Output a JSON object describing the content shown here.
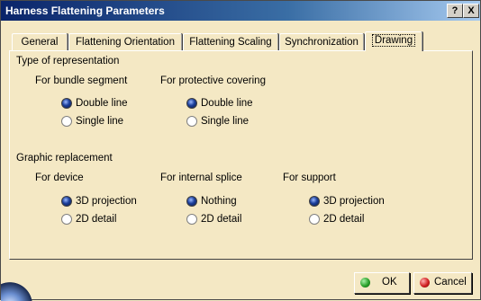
{
  "window": {
    "title": "Harness Flattening Parameters",
    "help_label": "?",
    "close_label": "X"
  },
  "tabs": [
    {
      "label": "General"
    },
    {
      "label": "Flattening Orientation"
    },
    {
      "label": "Flattening Scaling"
    },
    {
      "label": "Synchronization"
    },
    {
      "label": "Drawing"
    }
  ],
  "active_tab": "Drawing",
  "representation": {
    "heading": "Type of representation",
    "bundle": {
      "label": "For bundle segment",
      "options": [
        "Double line",
        "Single line"
      ],
      "selected": "Double line"
    },
    "covering": {
      "label": "For protective covering",
      "options": [
        "Double line",
        "Single line"
      ],
      "selected": "Double line"
    }
  },
  "replacement": {
    "heading": "Graphic replacement",
    "device": {
      "label": "For device",
      "options": [
        "3D projection",
        "2D detail"
      ],
      "selected": "3D projection"
    },
    "splice": {
      "label": "For internal splice",
      "options": [
        "Nothing",
        "2D detail"
      ],
      "selected": "Nothing"
    },
    "support": {
      "label": "For support",
      "options": [
        "3D projection",
        "2D detail"
      ],
      "selected": "3D projection"
    }
  },
  "buttons": {
    "ok": "OK",
    "cancel": "Cancel"
  },
  "colors": {
    "titlebar": "#0a246a",
    "ok_icon": "#2aa02a",
    "cancel_icon": "#d02020"
  }
}
